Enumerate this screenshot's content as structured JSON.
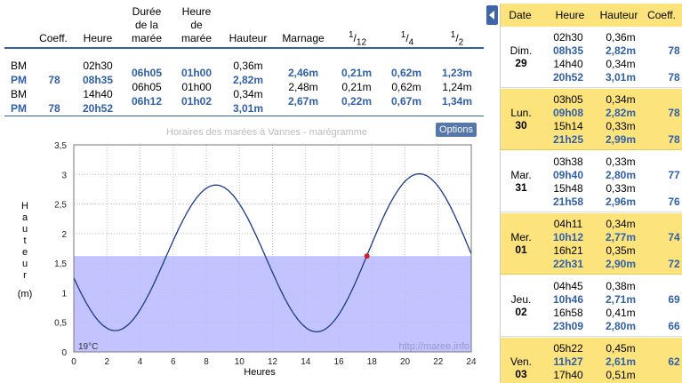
{
  "table": {
    "headers": {
      "coeff": "Coeff.",
      "heure": "Heure",
      "duree": [
        "Durée",
        "de la",
        "marée"
      ],
      "heure_maree": [
        "Heure",
        "de",
        "marée"
      ],
      "hauteur": "Hauteur",
      "marnage": "Marnage",
      "f12_num": "1",
      "f12_den": "12",
      "f4_num": "1",
      "f4_den": "4",
      "f2_num": "1",
      "f2_den": "2"
    },
    "types": [
      "BM",
      "PM",
      "BM",
      "PM"
    ],
    "coeffs": [
      "78",
      "78"
    ],
    "heures": [
      "02h30",
      "08h35",
      "14h40",
      "20h52"
    ],
    "durees": [
      "06h05",
      "06h05",
      "06h12"
    ],
    "heures_maree": [
      "01h00",
      "01h00",
      "01h02"
    ],
    "hauteurs": [
      "0,36m",
      "2,82m",
      "0,34m",
      "3,01m"
    ],
    "marnages": [
      "2,46m",
      "2,48m",
      "2,67m"
    ],
    "f12": [
      "0,21m",
      "0,21m",
      "0,22m"
    ],
    "f4": [
      "0,62m",
      "0,62m",
      "0,67m"
    ],
    "f2": [
      "1,23m",
      "1,24m",
      "1,34m"
    ]
  },
  "chart": {
    "title": "Horaires des marées à Vannes - marégramme",
    "options_label": "Options",
    "temperature": "19°C",
    "watermark": "http://maree.info",
    "ylabel": "Hauteur",
    "yunit": "(m)",
    "xlabel": "Heures"
  },
  "chart_data": {
    "type": "line",
    "title": "Horaires des marées à Vannes - marégramme",
    "xlabel": "Heures",
    "ylabel": "Hauteur (m)",
    "xlim": [
      0,
      24
    ],
    "ylim": [
      0,
      3.5
    ],
    "xticks": [
      "0",
      "2",
      "4",
      "6",
      "8",
      "10",
      "12",
      "14",
      "16",
      "18",
      "20",
      "22",
      "24"
    ],
    "yticks": [
      "0",
      "0,5",
      "1",
      "1,5",
      "2",
      "2,5",
      "3",
      "3,5"
    ],
    "grid": true,
    "extrema": [
      {
        "x": 2.5,
        "y": 0.36
      },
      {
        "x": 8.58,
        "y": 2.82
      },
      {
        "x": 14.67,
        "y": 0.34
      },
      {
        "x": 20.87,
        "y": 3.01
      }
    ],
    "x_range_curve": [
      0,
      24
    ],
    "current_level": 1.62,
    "current_time": 17.7,
    "colors": {
      "curve": "#1a3a8a",
      "fill": "#b9baff",
      "point": "#cc2222"
    }
  },
  "side": {
    "headers": [
      "Date",
      "Heure",
      "Hauteur",
      "Coeff."
    ],
    "days": [
      {
        "name": "Dim.",
        "num": "29",
        "color": "white",
        "rows": [
          [
            "02h30",
            "0,36m",
            ""
          ],
          [
            "08h35",
            "2,82m",
            "78"
          ],
          [
            "14h40",
            "0,34m",
            ""
          ],
          [
            "20h52",
            "3,01m",
            "78"
          ]
        ]
      },
      {
        "name": "Lun.",
        "num": "30",
        "color": "yellow",
        "rows": [
          [
            "03h05",
            "0,34m",
            ""
          ],
          [
            "09h08",
            "2,82m",
            "78"
          ],
          [
            "15h14",
            "0,33m",
            ""
          ],
          [
            "21h25",
            "2,99m",
            "78"
          ]
        ]
      },
      {
        "name": "Mar.",
        "num": "31",
        "color": "white",
        "rows": [
          [
            "03h38",
            "0,33m",
            ""
          ],
          [
            "09h40",
            "2,80m",
            "77"
          ],
          [
            "15h48",
            "0,33m",
            ""
          ],
          [
            "21h58",
            "2,96m",
            "76"
          ]
        ]
      },
      {
        "name": "Mer.",
        "num": "01",
        "color": "yellow",
        "rows": [
          [
            "04h11",
            "0,34m",
            ""
          ],
          [
            "10h12",
            "2,77m",
            "74"
          ],
          [
            "16h21",
            "0,35m",
            ""
          ],
          [
            "22h31",
            "2,90m",
            "72"
          ]
        ]
      },
      {
        "name": "Jeu.",
        "num": "02",
        "color": "white",
        "rows": [
          [
            "04h45",
            "0,38m",
            ""
          ],
          [
            "10h46",
            "2,71m",
            "69"
          ],
          [
            "16h58",
            "0,41m",
            ""
          ],
          [
            "23h09",
            "2,80m",
            "66"
          ]
        ]
      },
      {
        "name": "Ven.",
        "num": "03",
        "color": "yellow",
        "rows": [
          [
            "05h22",
            "0,45m",
            ""
          ],
          [
            "11h27",
            "2,61m",
            "62"
          ],
          [
            "17h40",
            "0,51m",
            ""
          ]
        ]
      }
    ]
  }
}
